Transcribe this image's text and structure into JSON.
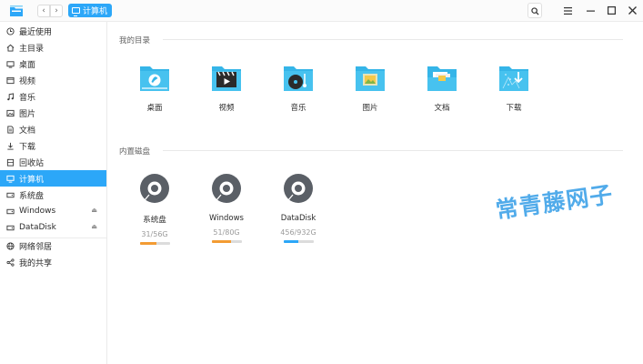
{
  "window": {
    "breadcrumb": "计算机",
    "back_glyph": "‹",
    "forward_glyph": "›"
  },
  "toolbar": {
    "search_icon": "search-icon",
    "menu_icon": "menu-icon",
    "minimize_icon": "minimize-icon",
    "maximize_icon": "maximize-icon",
    "close_icon": "close-icon"
  },
  "sidebar": {
    "items": [
      {
        "label": "最近使用",
        "icon": "clock-icon"
      },
      {
        "label": "主目录",
        "icon": "home-icon"
      },
      {
        "label": "桌面",
        "icon": "desktop-icon"
      },
      {
        "label": "视频",
        "icon": "video-icon"
      },
      {
        "label": "音乐",
        "icon": "music-icon"
      },
      {
        "label": "图片",
        "icon": "picture-icon"
      },
      {
        "label": "文档",
        "icon": "document-icon"
      },
      {
        "label": "下载",
        "icon": "download-icon"
      },
      {
        "label": "回收站",
        "icon": "trash-icon"
      }
    ],
    "devices": [
      {
        "label": "计算机",
        "icon": "computer-icon",
        "active": true
      },
      {
        "label": "系统盘",
        "icon": "disk-icon"
      },
      {
        "label": "Windows",
        "icon": "disk-icon",
        "eject": "⏏"
      },
      {
        "label": "DataDisk",
        "icon": "disk-icon",
        "eject": "⏏"
      }
    ],
    "network": [
      {
        "label": "网络邻居",
        "icon": "network-icon"
      },
      {
        "label": "我的共享",
        "icon": "share-icon"
      }
    ]
  },
  "main": {
    "my_dirs_title": "我的目录",
    "folders": [
      {
        "label": "桌面",
        "icon": "desktop-folder-icon"
      },
      {
        "label": "视频",
        "icon": "video-folder-icon"
      },
      {
        "label": "音乐",
        "icon": "music-folder-icon"
      },
      {
        "label": "图片",
        "icon": "picture-folder-icon"
      },
      {
        "label": "文档",
        "icon": "document-folder-icon"
      },
      {
        "label": "下载",
        "icon": "download-folder-icon"
      }
    ],
    "disks_title": "内置磁盘",
    "disks": [
      {
        "name": "系统盘",
        "usage": "31/56G",
        "used_fraction": 0.55,
        "bar_color": "#f39c33"
      },
      {
        "name": "Windows",
        "usage": "51/80G",
        "used_fraction": 0.64,
        "bar_color": "#f39c33"
      },
      {
        "name": "DataDisk",
        "usage": "456/932G",
        "used_fraction": 0.49,
        "bar_color": "#2ca7f8"
      }
    ]
  },
  "watermark": "常青藤网子",
  "colors": {
    "accent": "#2ca7f8",
    "folder": "#35b5e8",
    "disk_icon": "#5a5f66"
  }
}
